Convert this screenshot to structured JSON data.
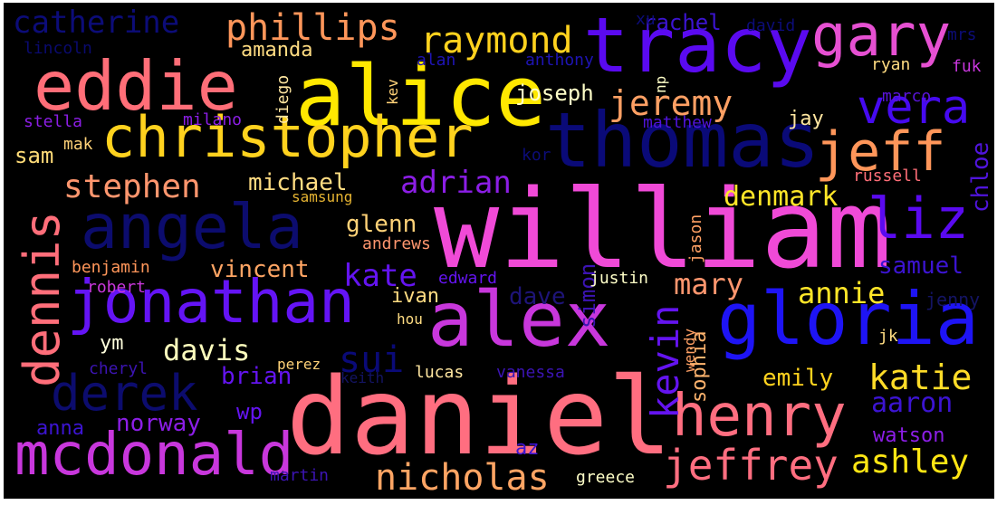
{
  "words": [
    {
      "text": "william",
      "color": "#f04ad7"
    },
    {
      "text": "daniel",
      "color": "#ff6e80"
    },
    {
      "text": "alice",
      "color": "#ffe800"
    },
    {
      "text": "thomas",
      "color": "#0a0a78"
    },
    {
      "text": "tracy",
      "color": "#5a0af0"
    },
    {
      "text": "christopher",
      "color": "#ffd21e"
    },
    {
      "text": "gloria",
      "color": "#1e14f5"
    },
    {
      "text": "alex",
      "color": "#c837dc"
    },
    {
      "text": "eddie",
      "color": "#ff6e78"
    },
    {
      "text": "jonathan",
      "color": "#6414f5"
    },
    {
      "text": "angela",
      "color": "#0c0c6e"
    },
    {
      "text": "henry",
      "color": "#ff6e80"
    },
    {
      "text": "mcdonald",
      "color": "#c837dc"
    },
    {
      "text": "gary",
      "color": "#e650d2"
    },
    {
      "text": "jeff",
      "color": "#ff965a"
    },
    {
      "text": "liz",
      "color": "#5a0af0"
    },
    {
      "text": "dennis",
      "color": "#ff6e7a"
    },
    {
      "text": "derek",
      "color": "#0c0c6e"
    },
    {
      "text": "vera",
      "color": "#460af0"
    },
    {
      "text": "jeffrey",
      "color": "#ff6e80"
    },
    {
      "text": "nicholas",
      "color": "#ffa564"
    },
    {
      "text": "phillips",
      "color": "#ff965a"
    },
    {
      "text": "raymond",
      "color": "#ffd21e"
    },
    {
      "text": "jeremy",
      "color": "#ffa064"
    },
    {
      "text": "stephen",
      "color": "#ff966e"
    },
    {
      "text": "adrian",
      "color": "#8c1ee6"
    },
    {
      "text": "catherine",
      "color": "#0c0c78"
    },
    {
      "text": "kevin",
      "color": "#6414f0"
    },
    {
      "text": "katie",
      "color": "#ffdc28"
    },
    {
      "text": "ashley",
      "color": "#ffe614"
    },
    {
      "text": "denmark",
      "color": "#ffe628"
    },
    {
      "text": "annie",
      "color": "#ffe628"
    },
    {
      "text": "mary",
      "color": "#ff966e"
    },
    {
      "text": "kate",
      "color": "#6414f0"
    },
    {
      "text": "davis",
      "color": "#ffffbe"
    },
    {
      "text": "sui",
      "color": "#0a0a78"
    },
    {
      "text": "michael",
      "color": "#ffdc82"
    },
    {
      "text": "joseph",
      "color": "#ffffc8"
    },
    {
      "text": "glenn",
      "color": "#ffd278"
    },
    {
      "text": "vincent",
      "color": "#ffa564"
    },
    {
      "text": "samuel",
      "color": "#3c14d2"
    },
    {
      "text": "aaron",
      "color": "#3c14d2"
    },
    {
      "text": "emily",
      "color": "#ffd21e"
    },
    {
      "text": "chloe",
      "color": "#5014dc"
    },
    {
      "text": "brian",
      "color": "#6414f0"
    },
    {
      "text": "norway",
      "color": "#8c1ee6"
    },
    {
      "text": "amanda",
      "color": "#ffdc82"
    },
    {
      "text": "rachel",
      "color": "#3c14d2"
    },
    {
      "text": "dave",
      "color": "#1e1478"
    },
    {
      "text": "ivan",
      "color": "#ffdc82"
    },
    {
      "text": "jay",
      "color": "#ffe6a0"
    },
    {
      "text": "watson",
      "color": "#8c1ee6"
    },
    {
      "text": "sophia",
      "color": "#ffb46e"
    },
    {
      "text": "simon",
      "color": "#3c14b4"
    },
    {
      "text": "wp",
      "color": "#6414f0"
    },
    {
      "text": "ym",
      "color": "#ffffdc"
    },
    {
      "text": "sam",
      "color": "#ffdc78"
    },
    {
      "text": "anna",
      "color": "#3c14d2"
    },
    {
      "text": "az",
      "color": "#3c14d2"
    },
    {
      "text": "jenny",
      "color": "#141464"
    },
    {
      "text": "lincoln",
      "color": "#0a0a6e"
    },
    {
      "text": "xu",
      "color": "#0c0c78"
    },
    {
      "text": "david",
      "color": "#0c0c78"
    },
    {
      "text": "mrs",
      "color": "#0c0c78"
    },
    {
      "text": "alan",
      "color": "#1e14b4"
    },
    {
      "text": "anthony",
      "color": "#1e14b4"
    },
    {
      "text": "np",
      "color": "#ffffc8"
    },
    {
      "text": "ryan",
      "color": "#ffdc82"
    },
    {
      "text": "marco",
      "color": "#5a14dc"
    },
    {
      "text": "fuk",
      "color": "#c837dc"
    },
    {
      "text": "kev",
      "color": "#ffd278"
    },
    {
      "text": "diego",
      "color": "#ffe6a0"
    },
    {
      "text": "stella",
      "color": "#8c1ee6"
    },
    {
      "text": "milano",
      "color": "#8c1ee6"
    },
    {
      "text": "mak",
      "color": "#ffd278"
    },
    {
      "text": "matthew",
      "color": "#5014dc"
    },
    {
      "text": "kor",
      "color": "#0c0c78"
    },
    {
      "text": "samsung",
      "color": "#e6b432"
    },
    {
      "text": "russell",
      "color": "#ff6e78"
    },
    {
      "text": "andrews",
      "color": "#ff966e"
    },
    {
      "text": "jason",
      "color": "#ffa064"
    },
    {
      "text": "benjamin",
      "color": "#ff965a"
    },
    {
      "text": "robert",
      "color": "#c837dc"
    },
    {
      "text": "edward",
      "color": "#6414f0"
    },
    {
      "text": "justin",
      "color": "#ffffc8"
    },
    {
      "text": "hou",
      "color": "#ffdc82"
    },
    {
      "text": "perez",
      "color": "#ffd278"
    },
    {
      "text": "jk",
      "color": "#ffdc82"
    },
    {
      "text": "wendy",
      "color": "#ffa064"
    },
    {
      "text": "cheryl",
      "color": "#3c14b4"
    },
    {
      "text": "keith",
      "color": "#141464"
    },
    {
      "text": "lucas",
      "color": "#ffe6a0"
    },
    {
      "text": "vanessa",
      "color": "#3c14b4"
    },
    {
      "text": "martin",
      "color": "#3c14b4"
    },
    {
      "text": "greece",
      "color": "#ffffc8"
    }
  ]
}
